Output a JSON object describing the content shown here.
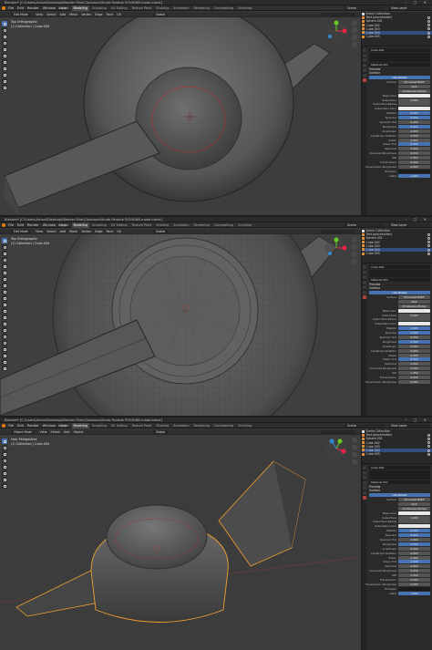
{
  "window": {
    "title": "Blender* [C:\\Users\\Antoni\\Desktop\\Blender Files\\Clockwork\\Knob Parable P/SV/KNB-mobe.blend]",
    "controls": "–  ▢  ✕"
  },
  "menu": [
    "File",
    "Edit",
    "Render",
    "Window",
    "Help"
  ],
  "workspace_tabs": [
    "Layout",
    "Modeling",
    "Sculpting",
    "UV Editing",
    "Texture Paint",
    "Shading",
    "Animation",
    "Rendering",
    "Compositing",
    "Scripting"
  ],
  "active_tab": "Modeling",
  "scene_name": "Scene",
  "view_layer": "View Layer",
  "viewport": {
    "edit_mode": "Edit Mode",
    "object_mode": "Object Mode",
    "menus_edit": [
      "View",
      "Select",
      "Add",
      "Mesh",
      "Vertex",
      "Edge",
      "Face",
      "UV"
    ],
    "menus_object": [
      "View",
      "Select",
      "Add",
      "Object"
    ],
    "orientation": "Global",
    "overlays": {
      "top_left_view": "Top Orthographic",
      "user_perspective": "User Perspective",
      "collection": "(1) Collection | Cube.004"
    }
  },
  "outliner_items": [
    {
      "name": "Scene Collection"
    },
    {
      "name": "Text.(placeholder)"
    },
    {
      "name": "Sphere.001"
    },
    {
      "name": "Cube.002"
    },
    {
      "name": "Cube.003"
    },
    {
      "name": "Cube.004"
    },
    {
      "name": "Cube.005"
    }
  ],
  "material": {
    "object": "Cube.004",
    "material_name": "Material.001",
    "sections": [
      "Preview",
      "Surface"
    ],
    "surface_button": "Use Nodes",
    "surface_shader": "Principled BSDF",
    "distribution": "GGX",
    "subsurface_method": "Christensen-Burley",
    "props": [
      {
        "label": "Base Color",
        "value": "",
        "style": "white"
      },
      {
        "label": "Subsurface",
        "value": "0.000",
        "style": ""
      },
      {
        "label": "Subsurface Radius",
        "value": "",
        "style": ""
      },
      {
        "label": "Subsurface Color",
        "value": "",
        "style": "white"
      },
      {
        "label": "Metallic",
        "value": "0.000",
        "style": "blue"
      },
      {
        "label": "Specular",
        "value": "0.500",
        "style": "blue"
      },
      {
        "label": "Specular Tint",
        "value": "0.000",
        "style": ""
      },
      {
        "label": "Roughness",
        "value": "0.500",
        "style": "blue"
      },
      {
        "label": "Anisotropic",
        "value": "0.000",
        "style": ""
      },
      {
        "label": "Anisotropic Rotation",
        "value": "0.000",
        "style": ""
      },
      {
        "label": "Sheen",
        "value": "0.000",
        "style": ""
      },
      {
        "label": "Sheen Tint",
        "value": "0.500",
        "style": "blue"
      },
      {
        "label": "Clearcoat",
        "value": "0.000",
        "style": ""
      },
      {
        "label": "Clearcoat Roughness",
        "value": "0.030",
        "style": ""
      },
      {
        "label": "IOR",
        "value": "1.450",
        "style": ""
      },
      {
        "label": "Transmission",
        "value": "0.000",
        "style": ""
      },
      {
        "label": "Transmission Roughness",
        "value": "0.000",
        "style": ""
      },
      {
        "label": "Emission",
        "value": "",
        "style": "dark"
      },
      {
        "label": "Alpha",
        "value": "1.000",
        "style": "blue"
      }
    ]
  },
  "colors": {
    "accent": "#4772b3",
    "selection_outline": "#f0a030",
    "edge_seam": "#c0392b"
  },
  "icons": [
    "select-box-icon",
    "cursor-icon",
    "move-icon",
    "rotate-icon",
    "scale-icon",
    "transform-icon",
    "annotate-icon",
    "measure-icon",
    "add-cube-icon",
    "extrude-icon",
    "inset-icon",
    "bevel-icon",
    "loop-cut-icon",
    "knife-icon",
    "poly-build-icon",
    "spin-icon",
    "smooth-icon",
    "edge-slide-icon",
    "shrink-icon",
    "shear-icon",
    "rip-icon"
  ]
}
